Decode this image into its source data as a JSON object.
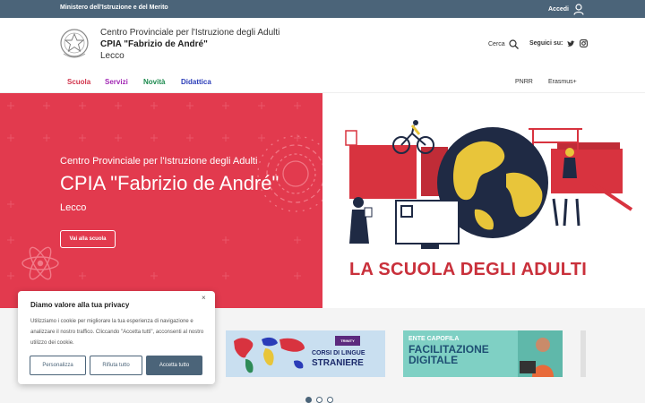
{
  "topbar": {
    "ministry": "Ministero dell'Istruzione e del Merito",
    "login_label": "Accedi"
  },
  "header": {
    "line1": "Centro Provinciale per l'Istruzione degli Adulti",
    "line2": "CPIA \"Fabrizio de André\"",
    "line3": "Lecco",
    "search_label": "Cerca",
    "follow_label": "Seguici su:",
    "icons": [
      "search-icon",
      "twitter-icon",
      "instagram-icon"
    ]
  },
  "nav": {
    "items": [
      {
        "label": "Scuola",
        "color": "#d1344b"
      },
      {
        "label": "Servizi",
        "color": "#a228b4"
      },
      {
        "label": "Novità",
        "color": "#1c8a4e"
      },
      {
        "label": "Didattica",
        "color": "#2a3cb8"
      }
    ],
    "right": [
      "PNRR",
      "Erasmus+"
    ]
  },
  "hero": {
    "line1": "Centro Provinciale per l'Istruzione degli Adulti",
    "line2": "CPIA \"Fabrizio de André\"",
    "line3": "Lecco",
    "button": "Vai alla scuola",
    "slogan": "LA SCUOLA DEGLI ADULTI",
    "accent": "#e23a4e"
  },
  "cards": [
    {
      "badge": "TRINITY",
      "line1": "CORSI DI LINGUE",
      "line2": "STRANIERE"
    },
    {
      "line1": "ENTE CAPOFILA",
      "line2": "FACILITAZIONE",
      "line3": "DIGITALE"
    }
  ],
  "carousel": {
    "slides": 3,
    "active": 1
  },
  "cookie": {
    "title": "Diamo valore alla tua privacy",
    "close": "×",
    "text": "Utilizziamo i cookie per migliorare la tua esperienza di navigazione e analizzare il nostro traffico. Cliccando \"Accetta tutti\", acconsenti al nostro utilizzo dei cookie.",
    "customize": "Personalizza",
    "reject": "Rifiuta tutto",
    "accept": "Accetta tutto"
  }
}
